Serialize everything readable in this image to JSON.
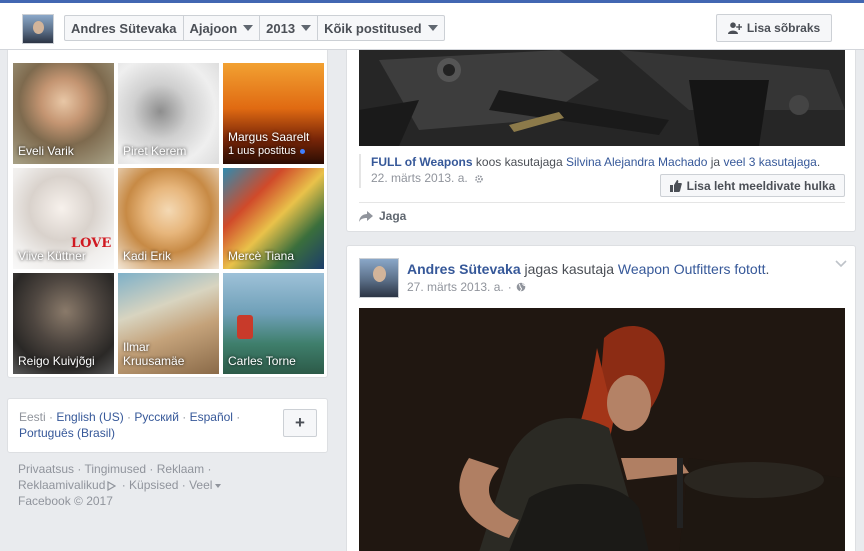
{
  "header": {
    "profile_name": "Andres Sütevaka",
    "timeline_menu": "Ajajoon",
    "year_menu": "2013",
    "filter_menu": "Kõik postitused",
    "add_friend_label": "Lisa sõbraks"
  },
  "friends": [
    {
      "name": "Eveli Varik",
      "sub": ""
    },
    {
      "name": "Piret Kerem",
      "sub": ""
    },
    {
      "name": "Margus Saarelt",
      "sub": "1 uus postitus"
    },
    {
      "name": "Viive Küttner",
      "sub": ""
    },
    {
      "name": "Kadi Erik",
      "sub": ""
    },
    {
      "name": "Mercè Tiana",
      "sub": ""
    },
    {
      "name": "Reigo Kuivjõgi",
      "sub": ""
    },
    {
      "name": "Ilmar\nKruusamäe",
      "sub": ""
    },
    {
      "name": "Carles Torne",
      "sub": ""
    }
  ],
  "tile_overlay_text": "LOVE",
  "languages": {
    "current": "Eesti",
    "options": [
      "English (US)",
      "Русский",
      "Español",
      "Português (Brasil)"
    ],
    "separator": " · "
  },
  "footer": {
    "links": [
      "Privaatsus",
      "Tingimused",
      "Reklaam",
      "Reklaamivalikud",
      "Küpsised",
      "Veel"
    ],
    "copyright": "Facebook © 2017"
  },
  "post1": {
    "page_name": "FULL of Weapons",
    "with_text": "koos kasutajaga",
    "with_person": "Silvina Alejandra Machado",
    "and_text": "ja",
    "others": "veel 3 kasutajaga",
    "period": ".",
    "date": "22. märts 2013. a.",
    "like_page_label": "Lisa leht meeldivate hulka",
    "share_label": "Jaga"
  },
  "post2": {
    "author": "Andres Sütevaka",
    "shared_text": "jagas kasutaja",
    "source_page": "Weapon Outfitters fotott",
    "period": ".",
    "date": "27. märts 2013. a.",
    "dot": "·"
  },
  "colors": {
    "brand_blue": "#4267b2",
    "link_blue": "#365899",
    "background": "#e9ebee"
  }
}
